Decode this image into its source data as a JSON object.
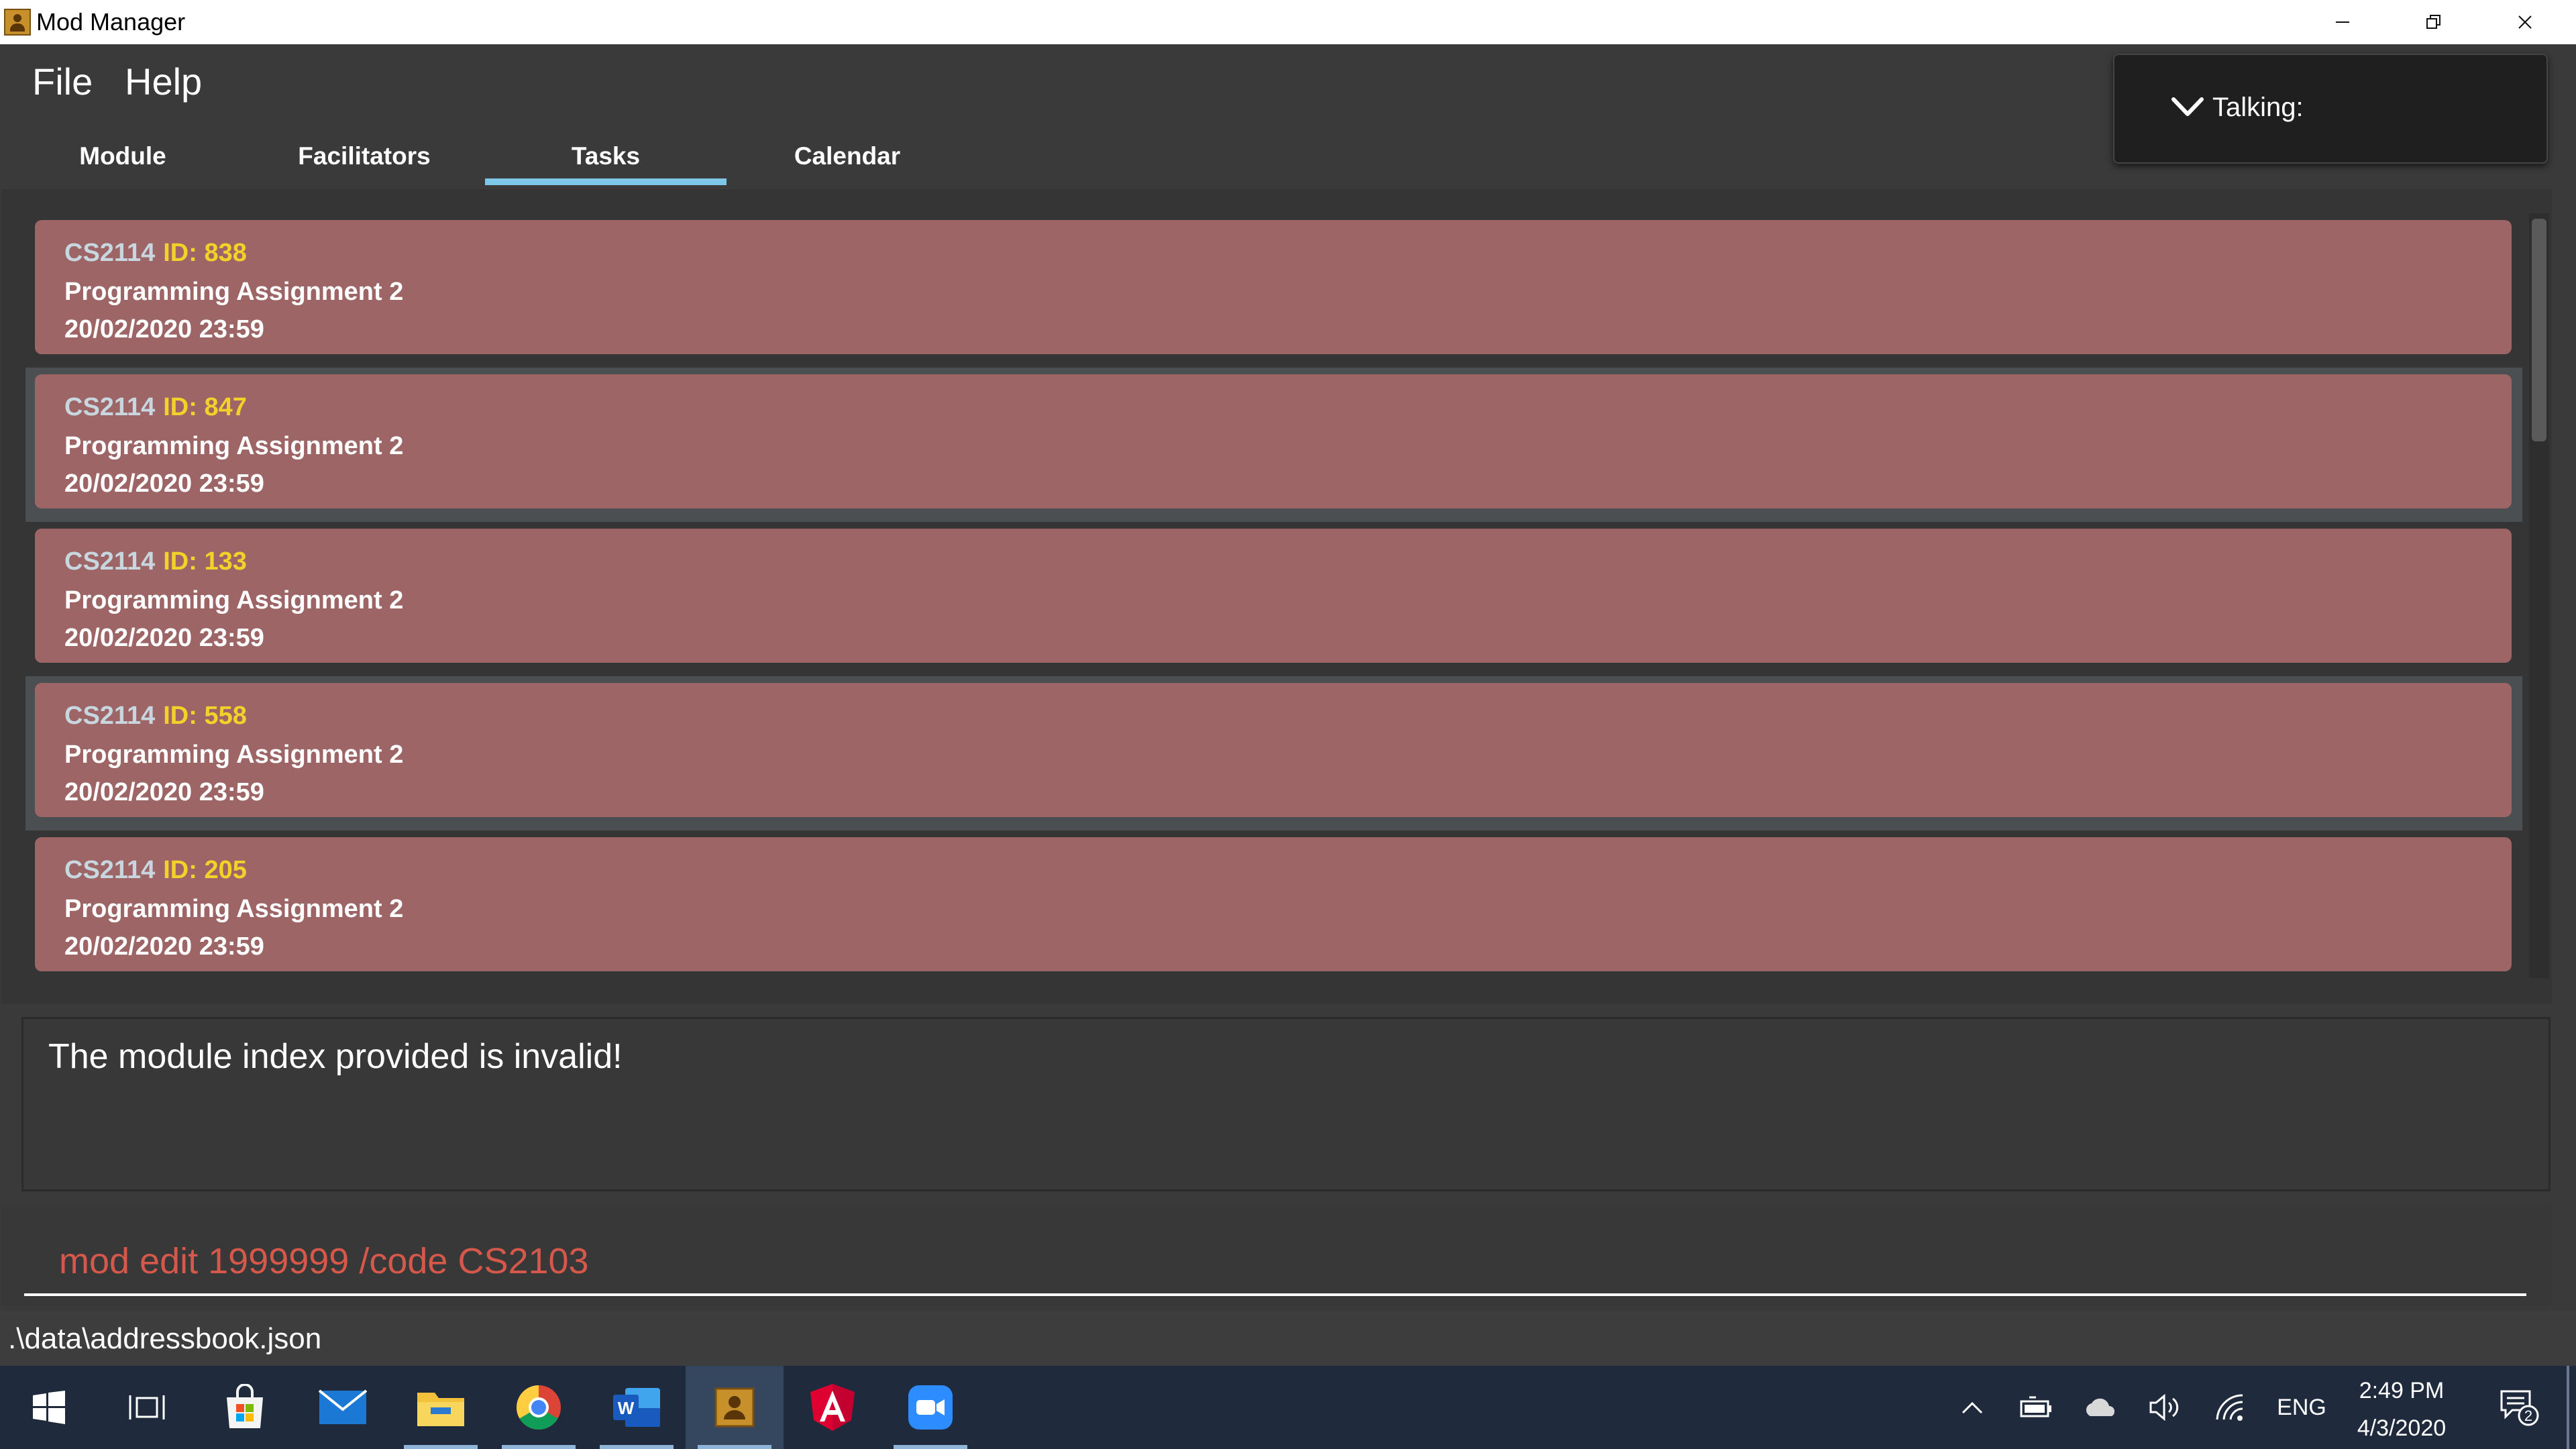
{
  "window": {
    "title": "Mod Manager"
  },
  "menu": {
    "file": "File",
    "help": "Help"
  },
  "tabs": [
    {
      "label": "Module",
      "selected": false
    },
    {
      "label": "Facilitators",
      "selected": false
    },
    {
      "label": "Tasks",
      "selected": true
    },
    {
      "label": "Calendar",
      "selected": false
    }
  ],
  "talking": {
    "label": "Talking:"
  },
  "tasks": [
    {
      "code": "CS2114",
      "id": "ID: 838",
      "description": "Programming Assignment 2",
      "datetime": "20/02/2020 23:59"
    },
    {
      "code": "CS2114",
      "id": "ID: 847",
      "description": "Programming Assignment 2",
      "datetime": "20/02/2020 23:59"
    },
    {
      "code": "CS2114",
      "id": "ID: 133",
      "description": "Programming Assignment 2",
      "datetime": "20/02/2020 23:59"
    },
    {
      "code": "CS2114",
      "id": "ID: 558",
      "description": "Programming Assignment 2",
      "datetime": "20/02/2020 23:59"
    },
    {
      "code": "CS2114",
      "id": "ID: 205",
      "description": "Programming Assignment 2",
      "datetime": "20/02/2020 23:59"
    }
  ],
  "result": {
    "message": "The module index provided is invalid!"
  },
  "command": {
    "value": "mod edit 1999999 /code CS2103"
  },
  "status": {
    "path": ".\\data\\addressbook.json"
  },
  "taskbar": {
    "apps": [
      "start-icon",
      "task-view-icon",
      "store-icon",
      "mail-icon",
      "file-explorer-icon",
      "chrome-icon",
      "word-icon",
      "mod-manager-icon",
      "angular-icon",
      "zoom-icon"
    ],
    "language": "ENG",
    "time": "2:49 PM",
    "date": "4/3/2020",
    "notification_count": "2"
  },
  "colors": {
    "card": "#9d6566",
    "module_code": "#c8d6df",
    "task_id": "#f2d12b",
    "command_text": "#d6584a",
    "tab_selected_underline": "#7ec7e8"
  }
}
